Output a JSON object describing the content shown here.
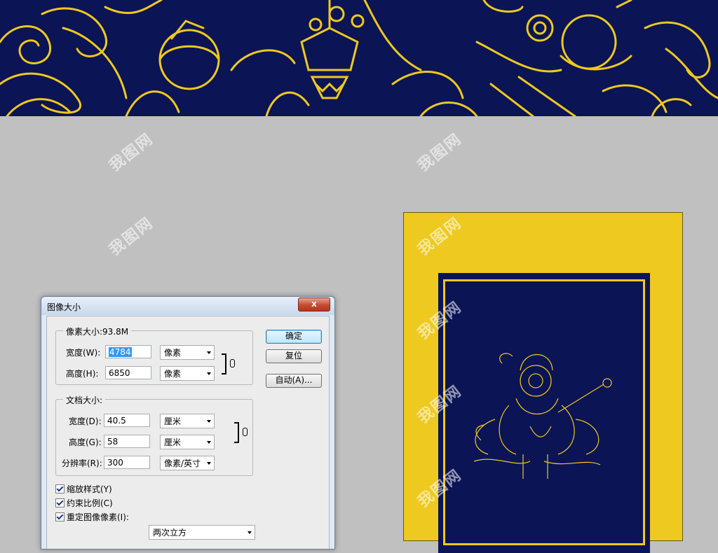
{
  "dialog": {
    "title": "图像大小",
    "close_label": "x",
    "pixel_dimensions": {
      "legend": "像素大小:93.8M",
      "width_label": "宽度(W):",
      "width_value": "4784",
      "width_unit": "像素",
      "height_label": "高度(H):",
      "height_value": "6850",
      "height_unit": "像素"
    },
    "document_size": {
      "legend": "文档大小:",
      "width_label": "宽度(D):",
      "width_value": "40.5",
      "width_unit": "厘米",
      "height_label": "高度(G):",
      "height_value": "58",
      "height_unit": "厘米",
      "resolution_label": "分辨率(R):",
      "resolution_value": "300",
      "resolution_unit": "像素/英寸"
    },
    "buttons": {
      "ok": "确定",
      "reset": "复位",
      "auto": "自动(A)..."
    },
    "options": {
      "scale_styles": "缩放样式(Y)",
      "constrain_proportions": "约束比例(C)",
      "resample_image": "重定图像像素(I):",
      "resample_method": "两次立方"
    }
  },
  "watermark_text": "我图网",
  "colors": {
    "banner_navy": "#0b1455",
    "gold": "#eec91f",
    "canvas_gray": "#c0c0c0"
  }
}
